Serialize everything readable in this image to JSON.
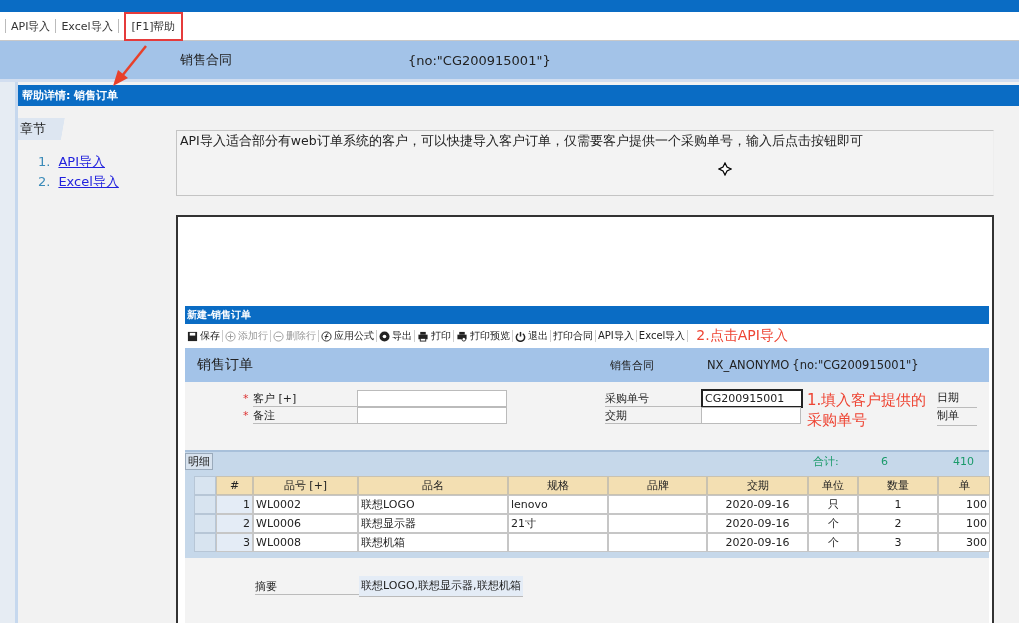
{
  "toolbar": {
    "items": [
      {
        "label": "API导入",
        "highlighted": false
      },
      {
        "label": "Excel导入",
        "highlighted": false
      },
      {
        "label": "[F1]帮助",
        "highlighted": true
      }
    ]
  },
  "header": {
    "label": "销售合同",
    "value": "{no:\"CG200915001\"}"
  },
  "help_window": {
    "title": "帮助详情: 销售订单",
    "chapters_heading": "章节",
    "chapters": [
      {
        "number": "1.",
        "label": "API导入"
      },
      {
        "number": "2.",
        "label": "Excel导入"
      }
    ],
    "description": "API导入适合部分有web订单系统的客户，可以快捷导入客户订单，仅需要客户提供一个采购单号，输入后点击按钮即可",
    "screenshot": {
      "title": "新建-销售订单",
      "toolbar": [
        {
          "label": "保存",
          "kind": "save",
          "disabled": false
        },
        {
          "label": "添加行",
          "kind": "plus",
          "disabled": true
        },
        {
          "label": "删除行",
          "kind": "minus",
          "disabled": true
        },
        {
          "label": "应用公式",
          "kind": "formula",
          "disabled": false
        },
        {
          "label": "导出",
          "kind": "export",
          "disabled": false
        },
        {
          "label": "打印",
          "kind": "print",
          "disabled": false
        },
        {
          "label": "打印预览",
          "kind": "preview",
          "disabled": false
        },
        {
          "label": "退出",
          "kind": "power",
          "disabled": false
        },
        {
          "label": "打印合同",
          "kind": "text",
          "disabled": false
        },
        {
          "label": "API导入",
          "kind": "text",
          "disabled": false
        },
        {
          "label": "Excel导入",
          "kind": "text",
          "disabled": false
        }
      ],
      "toolbar_note": "2.点击API导入",
      "form_title": "销售订单",
      "contract_label": "销售合同",
      "contract_value": "NX_ANONYMO",
      "contract_no": "{no:\"CG200915001\"}",
      "left_fields": [
        {
          "label": "客户 [+]",
          "marker": "*"
        },
        {
          "label": "备注",
          "marker": "*"
        }
      ],
      "right_fields": [
        {
          "label": "采购单号",
          "value": "CG200915001",
          "focused": true
        },
        {
          "label": "交期",
          "focused": false
        }
      ],
      "form_note": "1.填入客户提供的采购单号",
      "extra_labels": [
        "日期",
        "制单"
      ],
      "detail_tab": "明细",
      "total_label": "合计:",
      "total_qty": "6",
      "total_amount": "410",
      "columns": [
        "#",
        "品号 [+]",
        "品名",
        "规格",
        "品牌",
        "交期",
        "单位",
        "数量",
        "单"
      ],
      "rows": [
        [
          "1",
          "WL0002",
          "联想LOGO",
          "lenovo",
          "",
          "2020-09-16",
          "只",
          "1",
          "100"
        ],
        [
          "2",
          "WL0006",
          "联想显示器",
          "21寸",
          "",
          "2020-09-16",
          "个",
          "2",
          "100"
        ],
        [
          "3",
          "WL0008",
          "联想机箱",
          "",
          "",
          "2020-09-16",
          "个",
          "3",
          "300"
        ]
      ],
      "summary_label": "摘要",
      "summary_value": "联想LOGO,联想显示器,联想机箱"
    }
  }
}
